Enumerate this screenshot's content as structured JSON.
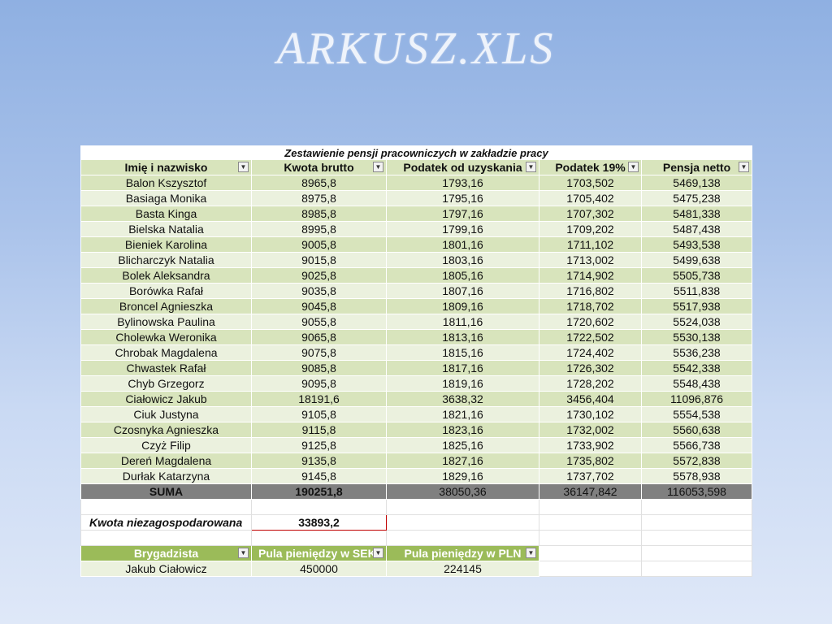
{
  "slide_title": "ARKUSZ.XLS",
  "table_title": "Zestawienie pensji pracowniczych w zakładzie pracy",
  "columns": [
    "Imię i nazwisko",
    "Kwota brutto",
    "Podatek od uzyskania",
    "Podatek 19%",
    "Pensja netto"
  ],
  "rows": [
    [
      "Balon Kszysztof",
      "8965,8",
      "1793,16",
      "1703,502",
      "5469,138"
    ],
    [
      "Basiaga Monika",
      "8975,8",
      "1795,16",
      "1705,402",
      "5475,238"
    ],
    [
      "Basta Kinga",
      "8985,8",
      "1797,16",
      "1707,302",
      "5481,338"
    ],
    [
      "Bielska Natalia",
      "8995,8",
      "1799,16",
      "1709,202",
      "5487,438"
    ],
    [
      "Bieniek Karolina",
      "9005,8",
      "1801,16",
      "1711,102",
      "5493,538"
    ],
    [
      "Blicharczyk Natalia",
      "9015,8",
      "1803,16",
      "1713,002",
      "5499,638"
    ],
    [
      "Bolek Aleksandra",
      "9025,8",
      "1805,16",
      "1714,902",
      "5505,738"
    ],
    [
      "Borówka Rafał",
      "9035,8",
      "1807,16",
      "1716,802",
      "5511,838"
    ],
    [
      "Broncel Agnieszka",
      "9045,8",
      "1809,16",
      "1718,702",
      "5517,938"
    ],
    [
      "Bylinowska Paulina",
      "9055,8",
      "1811,16",
      "1720,602",
      "5524,038"
    ],
    [
      "Cholewka Weronika",
      "9065,8",
      "1813,16",
      "1722,502",
      "5530,138"
    ],
    [
      "Chrobak Magdalena",
      "9075,8",
      "1815,16",
      "1724,402",
      "5536,238"
    ],
    [
      "Chwastek Rafał",
      "9085,8",
      "1817,16",
      "1726,302",
      "5542,338"
    ],
    [
      "Chyb Grzegorz",
      "9095,8",
      "1819,16",
      "1728,202",
      "5548,438"
    ],
    [
      "Ciałowicz Jakub",
      "18191,6",
      "3638,32",
      "3456,404",
      "11096,876"
    ],
    [
      "Ciuk Justyna",
      "9105,8",
      "1821,16",
      "1730,102",
      "5554,538"
    ],
    [
      "Czosnyka Agnieszka",
      "9115,8",
      "1823,16",
      "1732,002",
      "5560,638"
    ],
    [
      "Czyż Filip",
      "9125,8",
      "1825,16",
      "1733,902",
      "5566,738"
    ],
    [
      "Dereń Magdalena",
      "9135,8",
      "1827,16",
      "1735,802",
      "5572,838"
    ],
    [
      "Durłak Katarzyna",
      "9145,8",
      "1829,16",
      "1737,702",
      "5578,938"
    ]
  ],
  "sum_row": [
    "SUMA",
    "190251,8",
    "38050,36",
    "36147,842",
    "116053,598"
  ],
  "kwota_label": "Kwota niezagospodarowana",
  "kwota_value": "33893,2",
  "brigade_columns": [
    "Brygadzista",
    "Pula pieniędzy w SEK",
    "Pula pieniędzy w PLN"
  ],
  "brigade_row": [
    "Jakub Ciałowicz",
    "450000",
    "224145"
  ],
  "icons": {
    "dropdown": "dropdown-arrow-icon"
  },
  "colors": {
    "header_green": "#d8e4bc",
    "row_light": "#ebf1de",
    "brigade_header": "#9bbb59",
    "sum_gray": "#808080",
    "highlight_border": "#c00000"
  }
}
